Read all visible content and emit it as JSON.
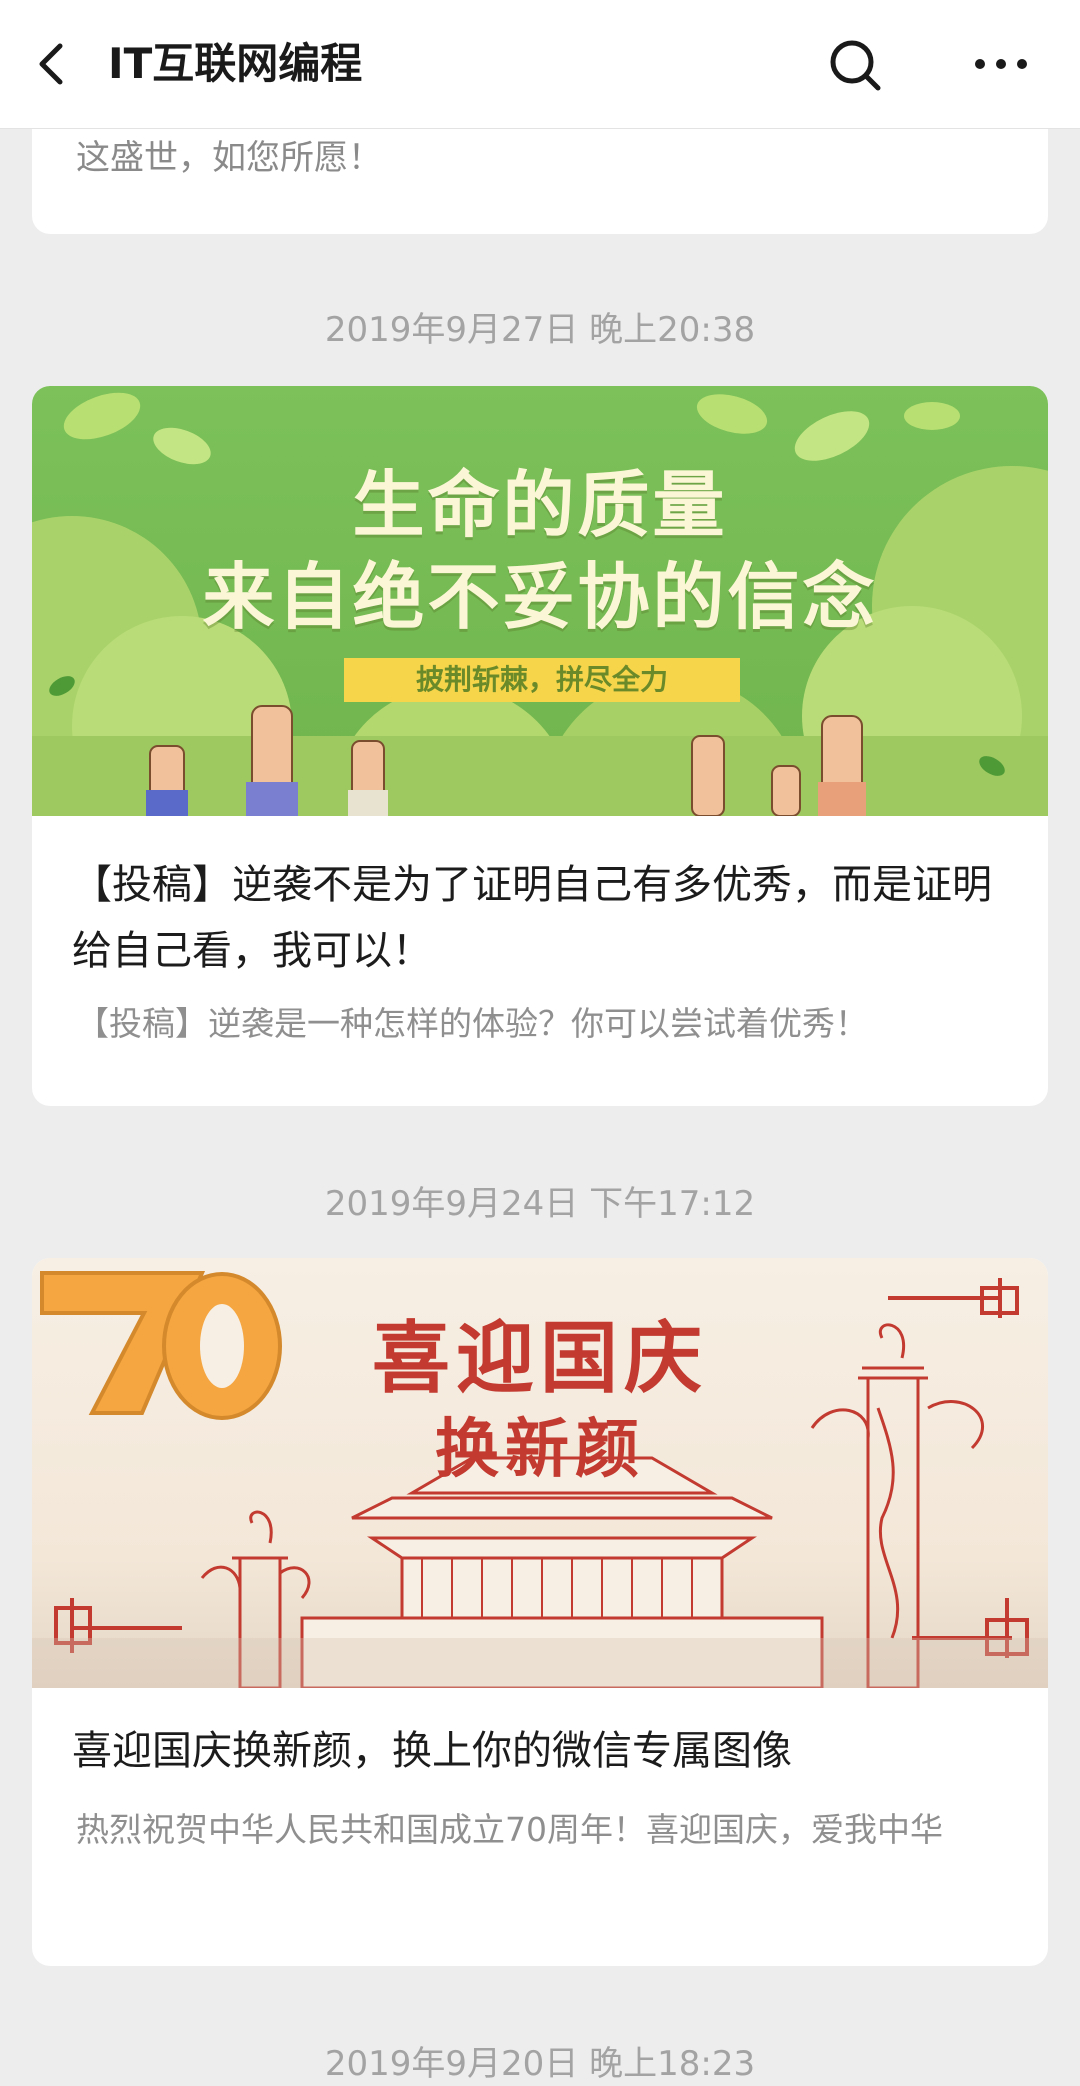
{
  "header": {
    "title": "IT互联网编程",
    "icons": {
      "back": "back-arrow-icon",
      "search": "search-icon",
      "more": "more-icon"
    }
  },
  "top_card": {
    "summary": "这盛世，如您所愿！"
  },
  "articles": [
    {
      "time": "2019年9月27日 晚上20:38",
      "banner": {
        "line1": "生命的质量",
        "line2": "来自绝不妥协的信念",
        "tag": "披荆斩棘，拼尽全力"
      },
      "title": "【投稿】逆袭不是为了证明自己有多优秀，而是证明给自己看，我可以！",
      "summary": "【投稿】逆袭是一种怎样的体验？你可以尝试着优秀！"
    },
    {
      "time": "2019年9月24日 下午17:12",
      "banner": {
        "seventy": "70",
        "line1": "喜迎国庆",
        "line2": "换新颜"
      },
      "title": "喜迎国庆换新颜，换上你的微信专属图像",
      "summary": "热烈祝贺中华人民共和国成立70周年！喜迎国庆，爱我中华"
    }
  ],
  "next_time": "2019年9月20日 晚上18:23",
  "colors": {
    "accent_green": "#7cc15a",
    "banner_red": "#c23a30",
    "background": "#ededed"
  }
}
